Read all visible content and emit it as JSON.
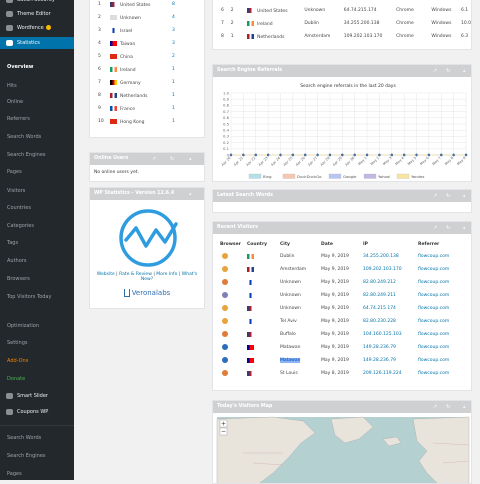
{
  "sidebar": {
    "top_items": [
      {
        "label": "Sucuri Security",
        "icon": "shield-icon"
      },
      {
        "label": "Theme Editor",
        "icon": "code-icon"
      },
      {
        "label": "Wordfence",
        "icon": "wordfence-icon",
        "badge": true
      },
      {
        "label": "Statistics",
        "icon": "chart-icon",
        "active": true
      }
    ],
    "sub_items": [
      "Overview",
      "Hits",
      "Online",
      "Referrers",
      "Search Words",
      "Search Engines",
      "Pages",
      "Visitors",
      "Countries",
      "Categories",
      "Tags",
      "Authors",
      "Browsers",
      "Top Visitors Today"
    ],
    "settings_items": [
      "Optimization",
      "Settings",
      "Add-Ons",
      "Donate"
    ],
    "bottom_items": [
      {
        "label": "Smart Slider",
        "icon": "slider-icon"
      },
      {
        "label": "Coupons WP",
        "icon": "gear-icon"
      }
    ],
    "extra_items": [
      "Search Words",
      "Search Engines",
      "Pages"
    ]
  },
  "top_countries": {
    "rows": [
      {
        "rank": "1",
        "country": "United States",
        "count": "8",
        "flag": [
          "#3c3b6e",
          "#b22234",
          "#ffffff"
        ]
      },
      {
        "rank": "2",
        "country": "Unknown",
        "count": "4",
        "flag": [
          "#dddddd",
          "#dddddd",
          "#dddddd"
        ]
      },
      {
        "rank": "3",
        "country": "Israel",
        "count": "3",
        "flag": [
          "#ffffff",
          "#0038b8",
          "#ffffff"
        ]
      },
      {
        "rank": "4",
        "country": "Taiwan",
        "count": "3",
        "flag": [
          "#000095",
          "#fe0000",
          "#fe0000"
        ]
      },
      {
        "rank": "5",
        "country": "China",
        "count": "2",
        "flag": [
          "#de2910",
          "#de2910",
          "#de2910"
        ]
      },
      {
        "rank": "6",
        "country": "Ireland",
        "count": "1",
        "flag": [
          "#169b62",
          "#ffffff",
          "#ff883e"
        ]
      },
      {
        "rank": "7",
        "country": "Germany",
        "count": "1",
        "flag": [
          "#000000",
          "#dd0000",
          "#ffce00"
        ]
      },
      {
        "rank": "8",
        "country": "Netherlands",
        "count": "1",
        "flag": [
          "#ae1c28",
          "#ffffff",
          "#21468b"
        ]
      },
      {
        "rank": "9",
        "country": "France",
        "count": "1",
        "flag": [
          "#0055a4",
          "#ffffff",
          "#ef4135"
        ]
      },
      {
        "rank": "10",
        "country": "Hong Kong",
        "count": "1",
        "flag": [
          "#de2910",
          "#de2910",
          "#de2910"
        ]
      }
    ]
  },
  "online_users": {
    "title": "Online Users",
    "empty": "No online users yet."
  },
  "about": {
    "title": "WP Statistics - Version 12.6.4",
    "links": [
      "Website",
      "Rate & Review",
      "More Info",
      "What's New?"
    ],
    "logo_text": "Veronalabs"
  },
  "top_visitors_partial": {
    "rows": [
      [
        "",
        "",
        "United States",
        "Unknown",
        "64.74.215.174",
        "Chrome",
        "Windows",
        "6.1"
      ],
      [
        "6",
        "2",
        "United States",
        "Unknown",
        "64.74.215.174",
        "Chrome",
        "Windows",
        "6.1"
      ],
      [
        "7",
        "2",
        "Ireland",
        "Dublin",
        "34.255.200.138",
        "Chrome",
        "Windows",
        "10.0"
      ],
      [
        "8",
        "1",
        "Netherlands",
        "Amsterdam",
        "109.202.103.170",
        "Chrome",
        "Windows",
        "6.3"
      ]
    ]
  },
  "referrals": {
    "title": "Search Engine Referrals",
    "chart_data": {
      "type": "line",
      "title": "Search engine referrals in the last 20 days",
      "ylim": [
        0,
        1.0
      ],
      "yticks": [
        "1.0",
        "0.9",
        "0.8",
        "0.7",
        "0.6",
        "0.5",
        "0.4",
        "0.3",
        "0.2",
        "0.1",
        "0"
      ],
      "categories": [
        "Apr 20",
        "Apr 21",
        "Apr 22",
        "Apr 23",
        "Apr 24",
        "Apr 25",
        "Apr 26",
        "Apr 27",
        "Apr 28",
        "Apr 29",
        "Apr 30",
        "May 1",
        "May 2",
        "May 3",
        "May 4",
        "May 5",
        "May 6",
        "May 7",
        "May 8",
        "May 9"
      ],
      "series": [
        {
          "name": "Bing",
          "color": "#b4e0e8",
          "values": [
            0,
            0,
            0,
            0,
            0,
            0,
            0,
            0,
            0,
            0,
            0,
            0,
            0,
            0,
            0,
            0,
            0,
            0,
            0,
            0
          ]
        },
        {
          "name": "DuckDuckGo",
          "color": "#f8c6b0",
          "values": [
            0,
            0,
            0,
            0,
            0,
            0,
            0,
            0,
            0,
            0,
            0,
            0,
            0,
            0,
            0,
            0,
            0,
            0,
            0,
            0
          ]
        },
        {
          "name": "Google",
          "color": "#b7c5f2",
          "values": [
            0,
            0,
            0,
            0,
            0,
            0,
            0,
            0,
            0,
            0,
            0,
            0,
            0,
            0,
            0,
            0,
            0,
            0,
            0,
            0
          ]
        },
        {
          "name": "Yahoo!",
          "color": "#c3b6e3",
          "values": [
            0,
            0,
            0,
            0,
            0,
            0,
            0,
            0,
            0,
            0,
            0,
            0,
            0,
            0,
            0,
            0,
            0,
            0,
            0,
            0
          ]
        },
        {
          "name": "Yandex",
          "color": "#f8e6a0",
          "values": [
            0,
            0,
            0,
            0,
            0,
            0,
            0,
            0,
            0,
            0,
            0,
            0,
            0,
            0,
            0,
            0,
            0,
            0,
            0,
            0
          ]
        }
      ]
    }
  },
  "latest_search_words": {
    "title": "Latest Search Words"
  },
  "recent_visitors": {
    "title": "Recent Visitors",
    "headers": [
      "Browser",
      "Country",
      "City",
      "Date",
      "IP",
      "Referrer"
    ],
    "rows": [
      {
        "browser": "#e8a33d",
        "country": [
          "#169b62",
          "#ffffff",
          "#ff883e"
        ],
        "city": "Dublin",
        "date": "May 9, 2019",
        "ip": "34.255.200.138",
        "ref": "flowcoup.com"
      },
      {
        "browser": "#e8a33d",
        "country": [
          "#ae1c28",
          "#ffffff",
          "#21468b"
        ],
        "city": "Amsterdam",
        "date": "May 9, 2019",
        "ip": "109.202.103.170",
        "ref": "flowcoup.com"
      },
      {
        "browser": "#e07b39",
        "country": [
          "#ffffff",
          "#0038b8",
          "#ffffff"
        ],
        "city": "Unknown",
        "date": "May 9, 2019",
        "ip": "82.80.249.212",
        "ref": "flowcoup.com"
      },
      {
        "browser": "#7f7fb8",
        "country": [
          "#ffffff",
          "#0038b8",
          "#ffffff"
        ],
        "city": "Unknown",
        "date": "May 9, 2019",
        "ip": "82.80.249.211",
        "ref": "flowcoup.com"
      },
      {
        "browser": "#e8a33d",
        "country": [
          "#3c3b6e",
          "#b22234",
          "#ffffff"
        ],
        "city": "Unknown",
        "date": "May 9, 2019",
        "ip": "64.74.215.174",
        "ref": "flowcoup.com"
      },
      {
        "browser": "#e8a33d",
        "country": [
          "#ffffff",
          "#0038b8",
          "#ffffff"
        ],
        "city": "Tel Aviv",
        "date": "May 9, 2019",
        "ip": "82.80.230.228",
        "ref": "flowcoup.com"
      },
      {
        "browser": "#e07b39",
        "country": [
          "#3c3b6e",
          "#b22234",
          "#ffffff"
        ],
        "city": "Buffalo",
        "date": "May 9, 2019",
        "ip": "104.160.125.103",
        "ref": "flowcoup.com"
      },
      {
        "browser": "#2a6ebb",
        "country": [
          "#000095",
          "#fe0000",
          "#fe0000"
        ],
        "city": "Matawan",
        "date": "May 9, 2019",
        "ip": "149.28.236.79",
        "ref": "flowcoup.com"
      },
      {
        "browser": "#2a6ebb",
        "country": [
          "#000095",
          "#fe0000",
          "#fe0000"
        ],
        "city": "Matawan",
        "date": "May 9, 2019",
        "ip": "149.28.236.79",
        "ref": "flowcoup.com",
        "highlight": true
      },
      {
        "browser": "#e07b39",
        "country": [
          "#3c3b6e",
          "#b22234",
          "#ffffff"
        ],
        "city": "St Louis",
        "date": "May 8, 2019",
        "ip": "209.126.119.224",
        "ref": "flowcoup.com"
      }
    ]
  },
  "map": {
    "title": "Today's Visitors Map",
    "zoom_in": "+",
    "zoom_out": "−"
  }
}
